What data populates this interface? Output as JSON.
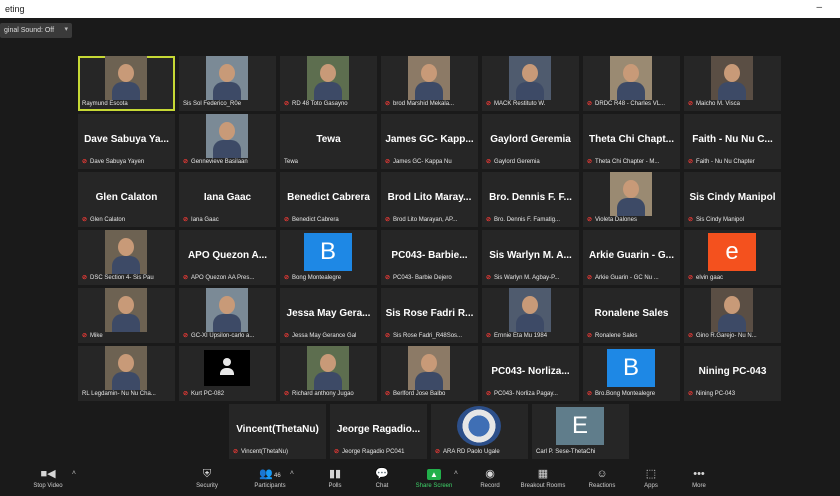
{
  "window": {
    "title": "eting",
    "minimize_glyph": "–"
  },
  "topbar": {
    "sound_label": "ginal Sound: Off",
    "sound_caret": "▾"
  },
  "colors": {
    "active_speaker": "#c6d835",
    "mic_muted": "#e53935",
    "avatar_blue": "#1e88e5",
    "avatar_orange": "#f4511e",
    "avatar_gray": "#607d8b",
    "share_green": "#22b04b"
  },
  "tiles": [
    {
      "label": "Raymund Escota",
      "kind": "photo",
      "active": true
    },
    {
      "label": "Sis Sol Federico_R0e",
      "kind": "photo"
    },
    {
      "label": "RD 48 Toto Gasayno",
      "kind": "photo",
      "mic_muted": true
    },
    {
      "label": "brod Marshid Mekala...",
      "kind": "photo",
      "mic_muted": true
    },
    {
      "label": "MACK Restituto W.",
      "kind": "photo",
      "mic_muted": true
    },
    {
      "label": "DRDC R48 - Charles VL...",
      "kind": "photo",
      "mic_muted": true
    },
    {
      "label": "Maicho M. Visca",
      "kind": "photo",
      "mic_muted": true
    },
    {
      "name": "Dave Sabuya Ya...",
      "label": "Dave Sabuya Yayen",
      "kind": "name",
      "mic_muted": true
    },
    {
      "label": "Gennevieve Basilaan",
      "kind": "photo",
      "mic_muted": true
    },
    {
      "name": "Tewa",
      "label": "Tewa",
      "kind": "name"
    },
    {
      "name": "James GC- Kapp...",
      "label": "James GC- Kappa Nu",
      "kind": "name",
      "mic_muted": true
    },
    {
      "name": "Gaylord Geremia",
      "label": "Gaylord Geremia",
      "kind": "name",
      "mic_muted": true
    },
    {
      "name": "Theta Chi Chapt...",
      "label": "Theta Chi Chapter - M...",
      "kind": "name",
      "mic_muted": true
    },
    {
      "name": "Faith - Nu Nu C...",
      "label": "Faith - Nu Nu Chapter",
      "kind": "name",
      "mic_muted": true
    },
    {
      "name": "Glen Calaton",
      "label": "Glen Calaton",
      "kind": "name",
      "mic_muted": true
    },
    {
      "name": "Iana Gaac",
      "label": "Iana Gaac",
      "kind": "name",
      "mic_muted": true
    },
    {
      "name": "Benedict Cabrera",
      "label": "Benedict Cabrera",
      "kind": "name",
      "mic_muted": true
    },
    {
      "name": "Brod Lito Maray...",
      "label": "Brod Lito Marayan, AP...",
      "kind": "name",
      "mic_muted": true
    },
    {
      "name": "Bro. Dennis F. F...",
      "label": "Bro. Dennis F. Famatig...",
      "kind": "name",
      "mic_muted": true
    },
    {
      "label": "Violeta Dalones",
      "kind": "photo",
      "mic_muted": true
    },
    {
      "name": "Sis Cindy Manipol",
      "label": "Sis Cindy Manipol",
      "kind": "name",
      "mic_muted": true
    },
    {
      "label": "DSC Section 4- Sis Pau",
      "kind": "photo",
      "mic_muted": true
    },
    {
      "name": "APO Quezon A...",
      "label": "APO Quezon AA Pres...",
      "kind": "name",
      "mic_muted": true
    },
    {
      "letter": "B",
      "label": "Bong Montealegre",
      "kind": "letter",
      "color": "#1e88e5",
      "mic_muted": true
    },
    {
      "name": "PC043- Barbie...",
      "label": "PC043- Barbie Dejero",
      "kind": "name",
      "mic_muted": true
    },
    {
      "name": "Sis Warlyn M. A...",
      "label": "Sis Warlyn M. Agbay-P...",
      "kind": "name",
      "mic_muted": true
    },
    {
      "name": "Arkie Guarin - G...",
      "label": "Arkie Guarin - GC Nu ...",
      "kind": "name",
      "mic_muted": true
    },
    {
      "letter": "e",
      "label": "elvin gaac",
      "kind": "letter",
      "color": "#f4511e",
      "mic_muted": true
    },
    {
      "label": "Mike",
      "kind": "photo",
      "mic_muted": true
    },
    {
      "label": "GC-XI Upsilon-carlo a...",
      "kind": "photo",
      "mic_muted": true
    },
    {
      "name": "Jessa May Gera...",
      "label": "Jessa May Gerance Gal",
      "kind": "name",
      "mic_muted": true
    },
    {
      "name": "Sis Rose Fadri R...",
      "label": "Sis Rose Fadri_R48Sos...",
      "kind": "name",
      "mic_muted": true
    },
    {
      "label": "Ernnie Eta Mu 1984",
      "kind": "photo",
      "mic_muted": true
    },
    {
      "name": "Ronalene Sales",
      "label": "Ronalene Sales",
      "kind": "name",
      "mic_muted": true
    },
    {
      "label": "Gino R.Garejo- Nu N...",
      "kind": "photo",
      "mic_muted": true
    },
    {
      "label": "RL Legdamin- Nu Nu Cha...",
      "kind": "photo"
    },
    {
      "label": "Kurt PC-082",
      "kind": "usericon",
      "mic_muted": true
    },
    {
      "label": "Richard anthony Jugao",
      "kind": "photo",
      "mic_muted": true
    },
    {
      "label": "Berlford Jose Balbo",
      "kind": "photo",
      "mic_muted": true
    },
    {
      "name": "PC043- Norliza...",
      "label": "PC043- Norliza Pagay...",
      "kind": "name",
      "mic_muted": true
    },
    {
      "letter": "B",
      "label": "Bro.Bong Montealegre",
      "kind": "letter",
      "color": "#1e88e5",
      "mic_muted": true
    },
    {
      "name": "Nining PC-043",
      "label": "Nining PC-043",
      "kind": "name",
      "mic_muted": true
    },
    {
      "name": "Vincent(ThetaNu)",
      "label": "Vincent(ThetaNu)",
      "kind": "name",
      "mic_muted": true
    },
    {
      "name": "Jeorge Ragadio...",
      "label": "Jeorge Ragadio PC041",
      "kind": "name",
      "mic_muted": true
    },
    {
      "label": "ARA RD Paolo Ugale",
      "kind": "seal",
      "mic_muted": true
    },
    {
      "letter": "E",
      "label": "Carl P. Sese-ThetaChi",
      "kind": "letter",
      "color": "#607d8b"
    }
  ],
  "toolbar": [
    {
      "id": "stop-video",
      "icon": "video-camera-icon",
      "glyph": "■◀",
      "label": "Stop Video",
      "caret": true
    },
    {
      "id": "security",
      "icon": "shield-icon",
      "glyph": "⛨",
      "label": "Security"
    },
    {
      "id": "participants",
      "icon": "participants-icon",
      "glyph": "👥",
      "label": "Participants",
      "badge": "46",
      "caret": true
    },
    {
      "id": "polls",
      "icon": "polls-icon",
      "glyph": "▮▮",
      "label": "Polls"
    },
    {
      "id": "chat",
      "icon": "chat-icon",
      "glyph": "💬",
      "label": "Chat"
    },
    {
      "id": "share-screen",
      "icon": "share-screen-icon",
      "glyph": "▲",
      "label": "Share Screen",
      "caret": true
    },
    {
      "id": "record",
      "icon": "record-icon",
      "glyph": "◉",
      "label": "Record"
    },
    {
      "id": "breakout-rooms",
      "icon": "breakout-rooms-icon",
      "glyph": "▦",
      "label": "Breakout Rooms"
    },
    {
      "id": "reactions",
      "icon": "reactions-icon",
      "glyph": "☺",
      "label": "Reactions"
    },
    {
      "id": "apps",
      "icon": "apps-icon",
      "glyph": "⬚",
      "label": "Apps"
    },
    {
      "id": "more",
      "icon": "more-icon",
      "glyph": "•••",
      "label": "More"
    }
  ]
}
